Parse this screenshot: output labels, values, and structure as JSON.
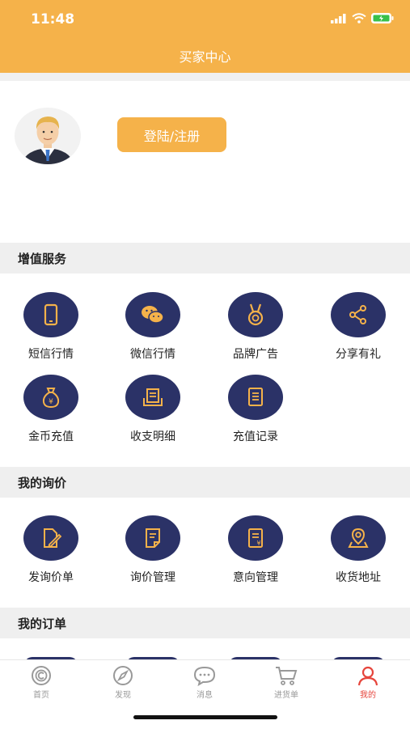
{
  "status_bar": {
    "time": "11:48"
  },
  "header": {
    "title": "买家中心"
  },
  "profile": {
    "login_label": "登陆/注册"
  },
  "sections": {
    "value_added": {
      "title": "增值服务",
      "items": [
        {
          "label": "短信行情",
          "icon": "phone-icon"
        },
        {
          "label": "微信行情",
          "icon": "wechat-icon"
        },
        {
          "label": "品牌广告",
          "icon": "medal-icon"
        },
        {
          "label": "分享有礼",
          "icon": "share-icon"
        },
        {
          "label": "金币充值",
          "icon": "money-bag-icon"
        },
        {
          "label": "收支明细",
          "icon": "ledger-icon"
        },
        {
          "label": "充值记录",
          "icon": "records-icon"
        }
      ]
    },
    "inquiry": {
      "title": "我的询价",
      "items": [
        {
          "label": "发询价单",
          "icon": "edit-document-icon"
        },
        {
          "label": "询价管理",
          "icon": "inquiry-document-icon"
        },
        {
          "label": "意向管理",
          "icon": "intent-document-icon"
        },
        {
          "label": "收货地址",
          "icon": "location-icon"
        }
      ]
    },
    "orders": {
      "title": "我的订单"
    }
  },
  "tabbar": {
    "items": [
      {
        "label": "首页",
        "icon": "home-coin-icon"
      },
      {
        "label": "发现",
        "icon": "compass-icon"
      },
      {
        "label": "消息",
        "icon": "chat-bubble-icon"
      },
      {
        "label": "进货单",
        "icon": "cart-icon"
      },
      {
        "label": "我的",
        "icon": "person-icon"
      }
    ],
    "active_index": 4,
    "active_color": "#e6453c",
    "inactive_color": "#999999"
  },
  "colors": {
    "accent": "#f5b24a",
    "icon_circle": "#2b3267",
    "icon_glyph": "#f5b24a"
  }
}
